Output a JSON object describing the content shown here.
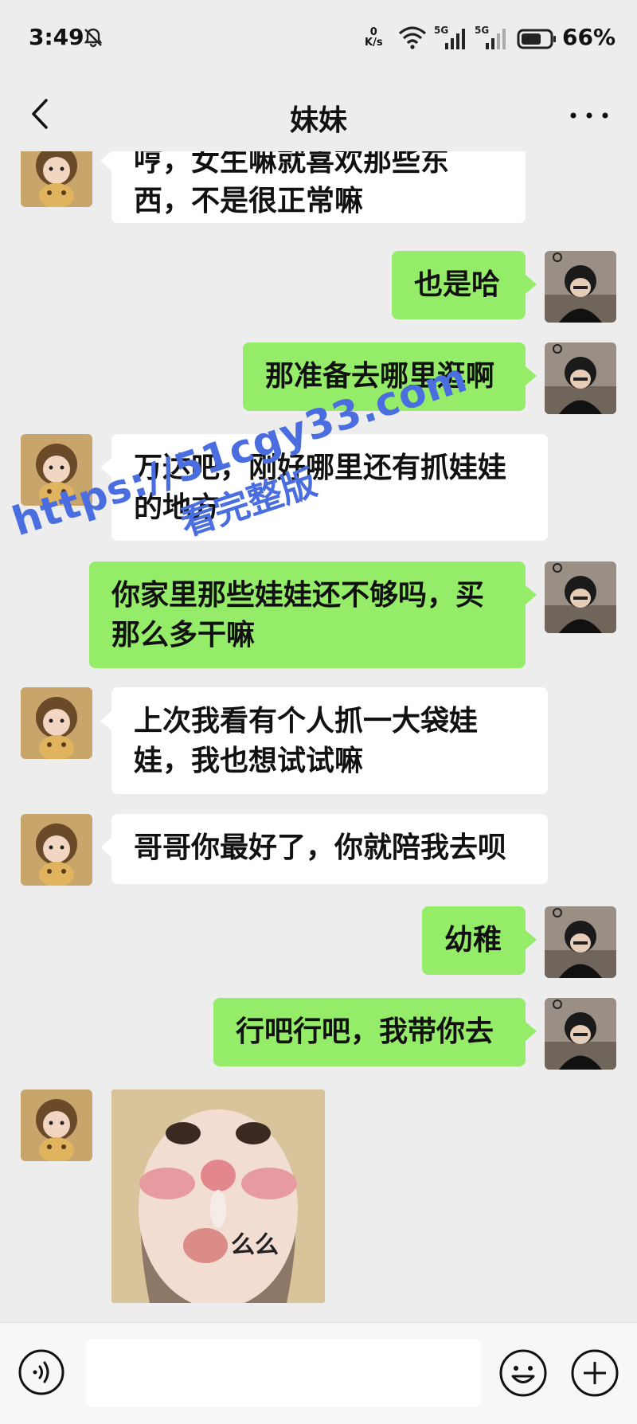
{
  "status_bar": {
    "time": "3:49",
    "net_speed_value": "0",
    "net_speed_unit": "K/s",
    "signal1_label": "5G",
    "signal2_label": "5G",
    "battery": "66%"
  },
  "header": {
    "title": "妹妹"
  },
  "messages": [
    {
      "side": "recv",
      "text": "哼，女生嘛就喜欢那些东西，不是很正常嘛"
    },
    {
      "side": "sent",
      "text": "也是哈"
    },
    {
      "side": "sent",
      "text": "那准备去哪里逛啊"
    },
    {
      "side": "recv",
      "text": "万达吧，刚好哪里还有抓娃娃的地方"
    },
    {
      "side": "sent",
      "text": "你家里那些娃娃还不够吗，买那么多干嘛"
    },
    {
      "side": "recv",
      "text": "上次我看有个人抓一大袋娃娃，我也想试试嘛"
    },
    {
      "side": "recv",
      "text": "哥哥你最好了，你就陪我去呗"
    },
    {
      "side": "sent",
      "text": "幼稚"
    },
    {
      "side": "sent",
      "text": "行吧行吧，我带你去"
    },
    {
      "side": "recv",
      "type": "sticker",
      "caption": "么么"
    }
  ],
  "watermark": {
    "line1": "https://51cgy33.com",
    "line2": "看完整版"
  },
  "input_bar": {
    "placeholder": "",
    "value": ""
  },
  "icons": {
    "back": "chevron-left-icon",
    "more": "more-dots-icon",
    "voice": "voice-icon",
    "emoji": "emoji-icon",
    "plus": "plus-icon"
  },
  "colors": {
    "background": "#ededed",
    "sent_bubble": "#95ec69",
    "recv_bubble": "#ffffff",
    "watermark": "#4a6ee0"
  }
}
